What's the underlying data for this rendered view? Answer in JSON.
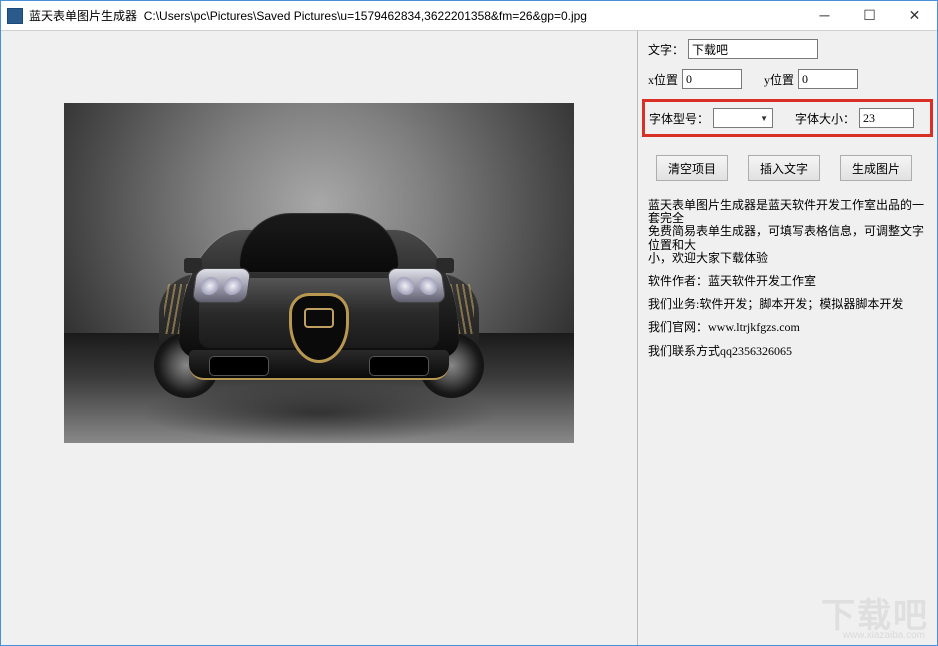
{
  "titlebar": {
    "app_name": "蓝天表单图片生成器",
    "file_path": "C:\\Users\\pc\\Pictures\\Saved Pictures\\u=1579462834,3622201358&fm=26&gp=0.jpg"
  },
  "form": {
    "text_label": "文字：",
    "text_value": "下载吧",
    "x_label": "x位置",
    "x_value": "0",
    "y_label": "y位置",
    "y_value": "0",
    "font_label": "字体型号：",
    "font_value": "",
    "size_label": "字体大小：",
    "size_value": "23"
  },
  "buttons": {
    "clear": "清空项目",
    "insert": "插入文字",
    "generate": "生成图片"
  },
  "info": {
    "line1": "蓝天表单图片生成器是蓝天软件开发工作室出品的一套完全",
    "line2": "免费简易表单生成器，可填写表格信息，可调整文字位置和大",
    "line3": "小，欢迎大家下载体验",
    "author_label": "软件作者：",
    "author_value": "蓝天软件开发工作室",
    "business_label": "我们业务:",
    "business_value": "软件开发；脚本开发；模拟器脚本开发",
    "website_label": "我们官网：",
    "website_value": "www.ltrjkfgzs.com",
    "contact_label": "我们联系方式",
    "contact_value": "qq2356326065"
  },
  "watermark": {
    "main": "下载吧",
    "sub": "www.xiazaiba.com"
  }
}
